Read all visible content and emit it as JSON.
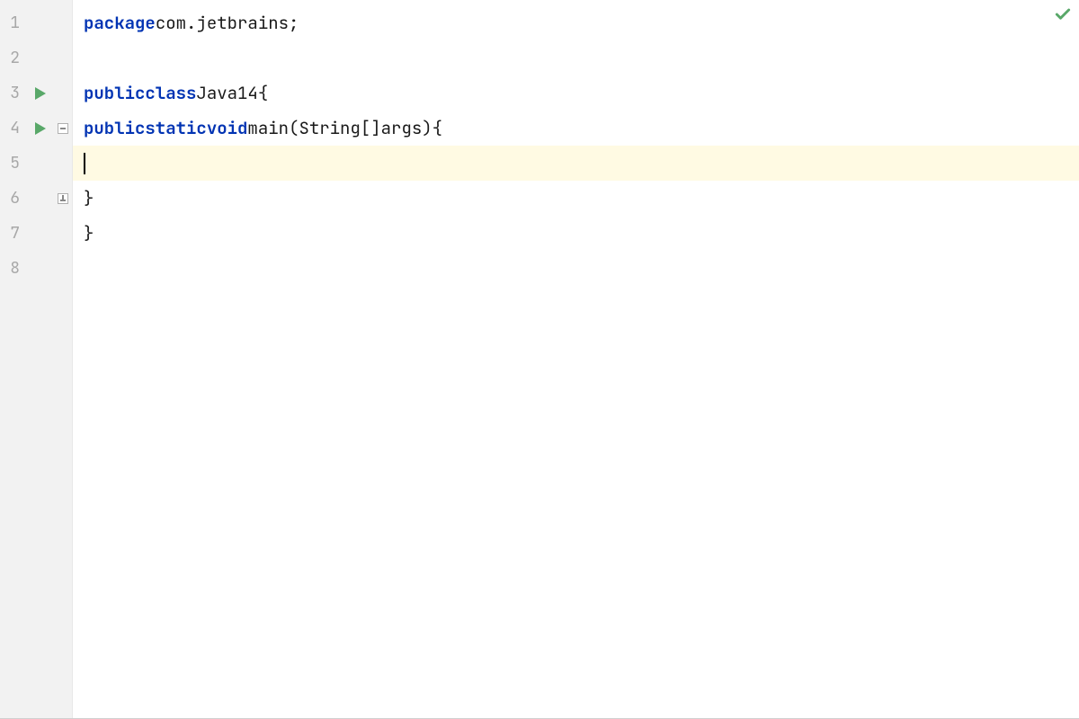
{
  "editor": {
    "lines": [
      "1",
      "2",
      "3",
      "4",
      "5",
      "6",
      "7",
      "8"
    ],
    "highlighted_line_index": 4,
    "code": {
      "line1": {
        "kw_package": "package",
        "package_name": "com.jetbrains",
        "semi": ";"
      },
      "line3": {
        "kw_public": "public",
        "kw_class": "class",
        "class_name": "Java14",
        "brace_open": "{"
      },
      "line4": {
        "kw_public": "public",
        "kw_static": "static",
        "kw_void": "void",
        "method_name": "main",
        "paren_open": "(",
        "param_type": "String[]",
        "param_name": "args",
        "paren_close": ")",
        "brace_open": "{"
      },
      "line6": {
        "brace_close": "}"
      },
      "line7": {
        "brace_close": "}"
      }
    }
  },
  "gutter": {
    "run_icons": [
      2,
      3
    ],
    "fold_start_line": 3,
    "fold_end_line": 5
  },
  "status": {
    "inspection": "ok"
  }
}
